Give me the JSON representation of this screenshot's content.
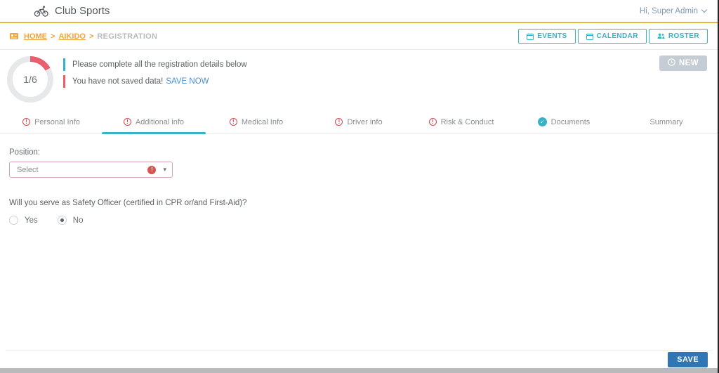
{
  "header": {
    "app_title": "Club Sports",
    "user_menu_label": "Hi, Super Admin"
  },
  "breadcrumb": {
    "separator": ">",
    "items": [
      {
        "label": "HOME",
        "type": "link"
      },
      {
        "label": "AIKIDO",
        "type": "link"
      },
      {
        "label": "REGISTRATION",
        "type": "current"
      }
    ]
  },
  "toolbar": {
    "buttons": [
      {
        "label": "EVENTS",
        "icon": "calendar-icon"
      },
      {
        "label": "CALENDAR",
        "icon": "calendar-icon"
      },
      {
        "label": "ROSTER",
        "icon": "people-icon"
      }
    ]
  },
  "progress": {
    "label": "1/6",
    "completed": 1,
    "total": 6
  },
  "alerts": [
    {
      "text": "Please complete all the registration details below",
      "severity": "info",
      "link": ""
    },
    {
      "text": "You have not saved data!",
      "severity": "danger",
      "link": "SAVE NOW"
    }
  ],
  "new_button": {
    "label": "NEW",
    "icon": "clock-icon"
  },
  "tabs": [
    {
      "label": "Personal Info",
      "status": "error",
      "active": false
    },
    {
      "label": "Additional info",
      "status": "error",
      "active": true
    },
    {
      "label": "Medical Info",
      "status": "error",
      "active": false
    },
    {
      "label": "Driver info",
      "status": "error",
      "active": false
    },
    {
      "label": "Risk & Conduct",
      "status": "error",
      "active": false
    },
    {
      "label": "Documents",
      "status": "done",
      "active": false
    },
    {
      "label": "Summary",
      "status": "none",
      "active": false
    }
  ],
  "form": {
    "position": {
      "label": "Position:",
      "value": "Select",
      "error": true
    },
    "safety_officer": {
      "question": "Will you serve as Safety Officer (certified in CPR or/and First-Aid)?",
      "options": [
        {
          "label": "Yes",
          "selected": false
        },
        {
          "label": "No",
          "selected": true
        }
      ]
    }
  },
  "footer": {
    "save_label": "SAVE"
  },
  "icons": {
    "dropdown_arrow": "▾"
  },
  "colors": {
    "accent_teal": "#36b3c6",
    "accent_yellow": "#eab73a",
    "accent_orange": "#f2a33b",
    "danger_red": "#e95f6f",
    "error_red": "#d9534f",
    "save_blue": "#3076b5",
    "link_blue": "#4a90d2",
    "disabled_gray": "#c4ccd4"
  }
}
